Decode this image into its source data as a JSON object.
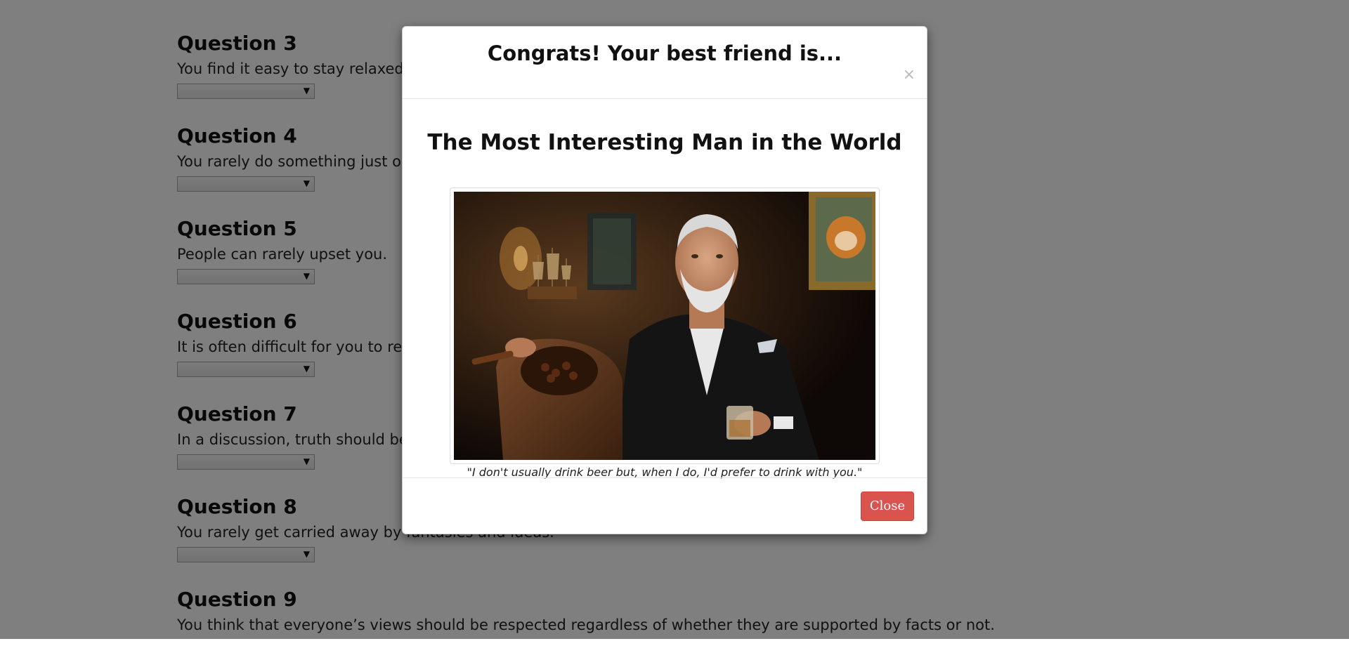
{
  "questions": [
    {
      "title": "Question 3",
      "text": "You find it easy to stay relaxed a"
    },
    {
      "title": "Question 4",
      "text": "You rarely do something just ou"
    },
    {
      "title": "Question 5",
      "text": "People can rarely upset you."
    },
    {
      "title": "Question 6",
      "text": "It is often difficult for you to rel"
    },
    {
      "title": "Question 7",
      "text": "In a discussion, truth should be"
    },
    {
      "title": "Question 8",
      "text": "You rarely get carried away by fantasies and ideas."
    },
    {
      "title": "Question 9",
      "text": "You think that everyone’s views should be respected regardless of whether they are supported by facts or not."
    }
  ],
  "dropdown_arrow": "▼",
  "modal": {
    "title": "Congrats! Your best friend is...",
    "close_x": "×",
    "friend_name": "The Most Interesting Man in the World",
    "quote": "\"I don't usually drink beer but, when I do, I'd prefer to drink with you.\"",
    "close_button": "Close"
  },
  "colors": {
    "backdrop": "#000000",
    "close_button_bg": "#d9534f",
    "close_button_text": "#ffffff"
  }
}
